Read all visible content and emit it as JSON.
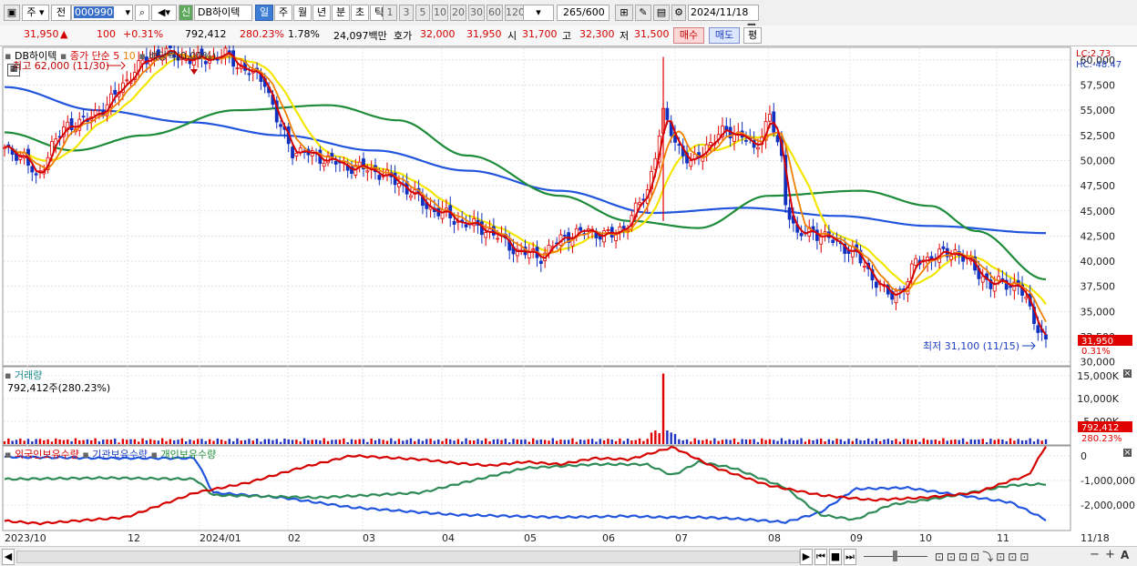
{
  "toolbar": {
    "mode_label": "주",
    "prev_label": "전",
    "code_value": "000990",
    "badge": "신",
    "stock_name": "DB하이텍",
    "period_tabs": [
      "일",
      "주",
      "월",
      "년",
      "분",
      "초",
      "틱"
    ],
    "interval_buttons": [
      "1",
      "3",
      "5",
      "10",
      "20",
      "30",
      "60",
      "120"
    ],
    "count_value": "265",
    "count_total": "/600",
    "date_value": "2024/11/18"
  },
  "quote": {
    "price": "31,950",
    "change_arrow": "▲",
    "change": "100",
    "change_pct": "+0.31%",
    "volume": "792,412",
    "vol_ratio": "280.23%",
    "turnover_pct": "1.78%",
    "amount": "24,097백만",
    "ask_label": "호가",
    "ask": "32,000",
    "bid": "31,950",
    "open_label": "시",
    "open": "31,700",
    "high_label": "고",
    "high": "32,300",
    "low_label": "저",
    "low": "31,500",
    "buy_label": "매수",
    "sell_label": "매도",
    "eval_label": "평"
  },
  "main_chart": {
    "title": "DB하이텍",
    "legend": [
      {
        "text": "종가 단순 5",
        "color": "#d40000"
      },
      {
        "text": "10",
        "color": "#f08000"
      },
      {
        "text": "배당락(0.00%)",
        "color": "#333333"
      }
    ],
    "high_note": "최고 62,000 (11/30)",
    "low_note": "최저 31,100 (11/15)",
    "lc": "LC:2.73",
    "hc": "HC:-48.47",
    "last_price_tag": "31,950",
    "last_pct_tag": "0.31%",
    "y_labels": [
      "60,000",
      "57,500",
      "55,000",
      "52,500",
      "50,000",
      "47,500",
      "45,000",
      "42,500",
      "40,000",
      "37,500",
      "35,000",
      "32,500",
      "30,000"
    ]
  },
  "volume_panel": {
    "title": "거래량",
    "value": "792,412주(280.23%)",
    "y_labels": [
      "15,000K",
      "10,000K",
      "5,000K"
    ],
    "tag_value": "792,412",
    "tag_pct": "280.23%"
  },
  "holdings_panel": {
    "legend": [
      "외국인보유수량",
      "기관보유수량",
      "개인보유수량"
    ],
    "y_labels": [
      "0",
      "-1,000,000",
      "-2,000,000"
    ]
  },
  "x_labels": [
    "2023/10",
    "12",
    "2024/01",
    "02",
    "03",
    "04",
    "05",
    "06",
    "07",
    "08",
    "09",
    "10",
    "11",
    "11/18"
  ],
  "colors": {
    "ma5": "#d40000",
    "ma10": "#f08000",
    "ma20": "#f5e600",
    "ma60": "#1e8c3a",
    "ma120": "#2255dd",
    "candle_up": "#e00000",
    "candle_down": "#1030c0"
  }
}
